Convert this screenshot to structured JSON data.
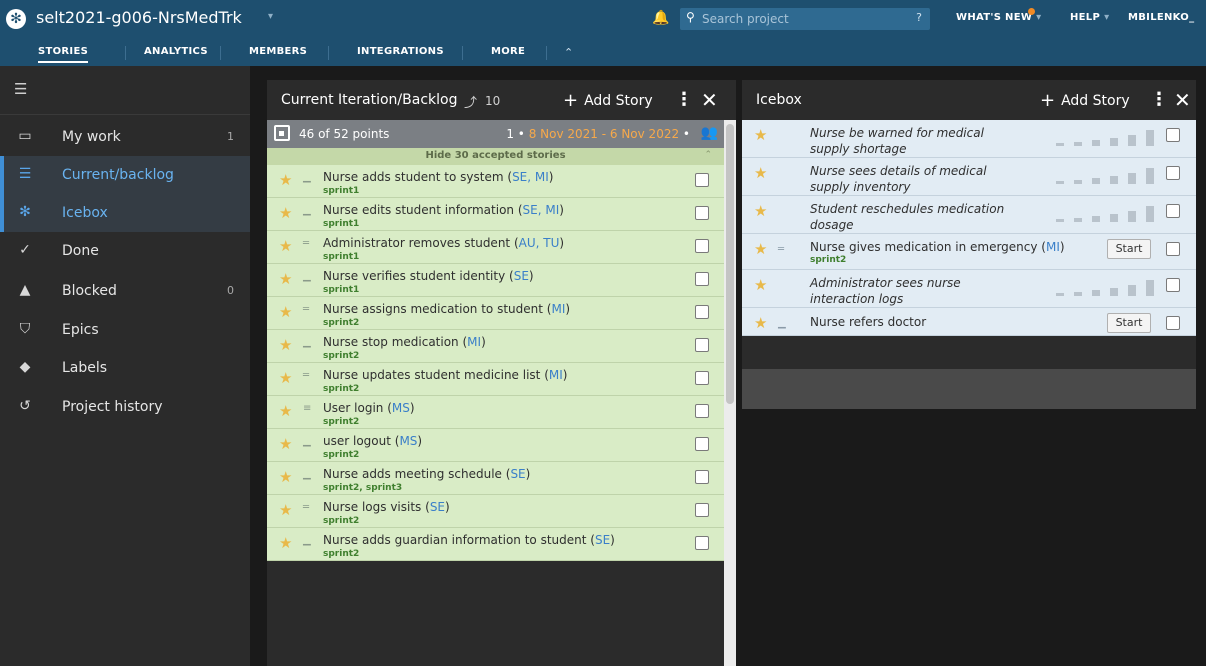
{
  "header": {
    "project_title": "selt2021-g006-NrsMedTrk",
    "search_placeholder": "Search project",
    "search_help": "?",
    "whats_new": "WHAT'S NEW",
    "help": "HELP",
    "user": "MBILENKO_",
    "tabs": [
      {
        "label": "STORIES",
        "active": true
      },
      {
        "label": "ANALYTICS"
      },
      {
        "label": "MEMBERS"
      },
      {
        "label": "INTEGRATIONS"
      },
      {
        "label": "MORE"
      }
    ]
  },
  "sidebar": {
    "items": [
      {
        "label": "My work",
        "count": "1",
        "icon": "inbox-icon"
      },
      {
        "label": "Current/backlog",
        "count": "",
        "icon": "list-icon",
        "active": true
      },
      {
        "label": "Icebox",
        "count": "",
        "icon": "snowflake-icon",
        "active": true
      },
      {
        "label": "Done",
        "count": "",
        "icon": "check-icon"
      },
      {
        "label": "Blocked",
        "count": "0",
        "icon": "warning-icon"
      },
      {
        "label": "Epics",
        "count": "",
        "icon": "shield-icon"
      },
      {
        "label": "Labels",
        "count": "",
        "icon": "tag-icon"
      },
      {
        "label": "Project history",
        "count": "",
        "icon": "history-icon"
      }
    ]
  },
  "backlog": {
    "title": "Current Iteration/Backlog",
    "velocity": "10",
    "add_story": "Add Story",
    "iteration": {
      "points": "46 of 52 points",
      "number": "1",
      "dates": "8 Nov 2021 - 6 Nov 2022"
    },
    "accepted_toggle": "Hide 30 accepted stories",
    "stories": [
      {
        "title": "Nurse adds student to system",
        "owners": "SE, MI",
        "label": "sprint1"
      },
      {
        "title": "Nurse edits student information",
        "owners": "SE, MI",
        "label": "sprint1"
      },
      {
        "title": "Administrator removes student",
        "owners": "AU, TU",
        "label": "sprint1"
      },
      {
        "title": "Nurse verifies student identity",
        "owners": "SE",
        "label": "sprint1"
      },
      {
        "title": "Nurse assigns medication to student",
        "owners": "MI",
        "label": "sprint2"
      },
      {
        "title": "Nurse stop medication",
        "owners": "MI",
        "label": "sprint2"
      },
      {
        "title": "Nurse updates student medicine list",
        "owners": "MI",
        "label": "sprint2"
      },
      {
        "title": "User login",
        "owners": "MS",
        "label": "sprint2"
      },
      {
        "title": "user logout",
        "owners": "MS",
        "label": "sprint2"
      },
      {
        "title": "Nurse adds meeting schedule",
        "owners": "SE",
        "label": "sprint2, sprint3"
      },
      {
        "title": "Nurse logs visits",
        "owners": "SE",
        "label": "sprint2"
      },
      {
        "title": "Nurse adds guardian information to student",
        "owners": "SE",
        "label": "sprint2"
      }
    ]
  },
  "icebox": {
    "title": "Icebox",
    "add_story": "Add Story",
    "start_label": "Start",
    "stories": [
      {
        "title": "Nurse be warned for medical supply shortage",
        "italic": true
      },
      {
        "title": "Nurse sees details of medical supply inventory",
        "italic": true
      },
      {
        "title": "Student reschedules medication dosage",
        "italic": true
      },
      {
        "title": "Nurse gives medication in emergency",
        "owners": "MI",
        "label": "sprint2",
        "start": true
      },
      {
        "title": "Administrator sees nurse interaction logs",
        "italic": true
      },
      {
        "title": "Nurse refers doctor",
        "start": true
      }
    ]
  }
}
